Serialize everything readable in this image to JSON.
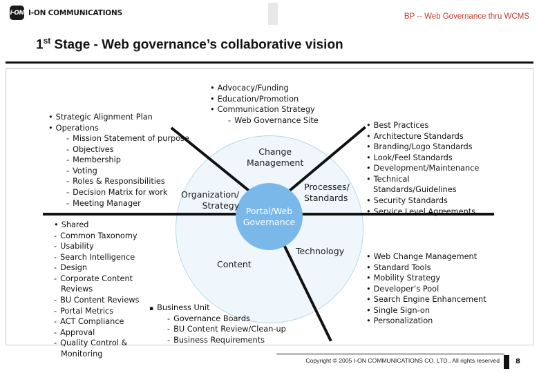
{
  "header": {
    "logo_text": "I-ON COMMUNICATIONS",
    "logo_mark": "i-ON",
    "bp_label": "BP -- Web Governance thru WCMS",
    "title_prefix": "1",
    "title_sup": "st",
    "title_rest": " Stage - Web governance’s collaborative vision"
  },
  "center": {
    "inner_label": "Portal/Web\nGovernance",
    "outer_circle_color": "#eff7fc",
    "inner_circle_color": "#7ab8ea",
    "quadrants": {
      "change_management": "Change\nManagement",
      "processes_standards": "Processes/\nStandards",
      "technology": "Technology",
      "content": "Content",
      "organization_strategy": "Organization/\nStrategy"
    }
  },
  "blocks": {
    "top": [
      {
        "level": 1,
        "bullet": "dot",
        "text": "Advocacy/Funding"
      },
      {
        "level": 1,
        "bullet": "dot",
        "text": "Education/Promotion"
      },
      {
        "level": 1,
        "bullet": "dot",
        "text": "Communication Strategy"
      },
      {
        "level": 2,
        "bullet": "dash",
        "text": "Web Governance Site"
      }
    ],
    "left": [
      {
        "level": 1,
        "bullet": "dot",
        "text": "Strategic Alignment Plan"
      },
      {
        "level": 1,
        "bullet": "dot",
        "text": "Operations"
      },
      {
        "level": 2,
        "bullet": "dash",
        "text": "Mission Statement of purpose"
      },
      {
        "level": 2,
        "bullet": "dash",
        "text": "Objectives"
      },
      {
        "level": 2,
        "bullet": "dash",
        "text": "Membership"
      },
      {
        "level": 2,
        "bullet": "dash",
        "text": "Voting"
      },
      {
        "level": 2,
        "bullet": "dash",
        "text": "Roles & Responsibilities"
      },
      {
        "level": 2,
        "bullet": "dash",
        "text": "Decision Matrix for work"
      },
      {
        "level": 2,
        "bullet": "dash",
        "text": "Meeting Manager"
      }
    ],
    "right": [
      {
        "level": 1,
        "bullet": "dot",
        "text": "Best Practices"
      },
      {
        "level": 1,
        "bullet": "dot",
        "text": "Architecture Standards"
      },
      {
        "level": 1,
        "bullet": "dot",
        "text": "Branding/Logo Standards"
      },
      {
        "level": 1,
        "bullet": "dot",
        "text": "Look/Feel Standards"
      },
      {
        "level": 1,
        "bullet": "dot",
        "text": "Development/Maintenance"
      },
      {
        "level": 1,
        "bullet": "dot",
        "text": "Technical"
      },
      {
        "level": 1,
        "bullet": "none",
        "text": "Standards/Guidelines"
      },
      {
        "level": 1,
        "bullet": "dot",
        "text": "Security Standards"
      },
      {
        "level": 1,
        "bullet": "dot",
        "text": "Service Level Agreements"
      }
    ],
    "lower_left": [
      {
        "level": 1,
        "bullet": "dot",
        "text": "Shared"
      },
      {
        "level": 1,
        "bullet": "dash",
        "text": "Common Taxonomy"
      },
      {
        "level": 1,
        "bullet": "dash",
        "text": "Usability"
      },
      {
        "level": 1,
        "bullet": "dash",
        "text": "Search Intelligence"
      },
      {
        "level": 1,
        "bullet": "dash",
        "text": "Design"
      },
      {
        "level": 1,
        "bullet": "dash",
        "text": "Corporate Content"
      },
      {
        "level": 1,
        "bullet": "none",
        "text": "Reviews"
      },
      {
        "level": 1,
        "bullet": "dash",
        "text": "BU Content Reviews"
      },
      {
        "level": 1,
        "bullet": "dash",
        "text": "Portal Metrics"
      },
      {
        "level": 1,
        "bullet": "dash",
        "text": "ACT Compliance"
      },
      {
        "level": 1,
        "bullet": "dash",
        "text": "Approval"
      },
      {
        "level": 1,
        "bullet": "dash",
        "text": "Quality Control &"
      },
      {
        "level": 1,
        "bullet": "none",
        "text": "Monitoring"
      }
    ],
    "business_unit": [
      {
        "level": 1,
        "bullet": "sq",
        "text": "Business Unit"
      },
      {
        "level": 2,
        "bullet": "dash",
        "text": "Governance Boards"
      },
      {
        "level": 2,
        "bullet": "dash",
        "text": "BU Content Review/Clean-up"
      },
      {
        "level": 2,
        "bullet": "dash",
        "text": "Business Requirements"
      }
    ],
    "bottom_right": [
      {
        "level": 1,
        "bullet": "dot",
        "text": "Web Change Management"
      },
      {
        "level": 1,
        "bullet": "dot",
        "text": "Standard Tools"
      },
      {
        "level": 1,
        "bullet": "dot",
        "text": "Mobility Strategy"
      },
      {
        "level": 1,
        "bullet": "dot",
        "text": "Developer’s Pool"
      },
      {
        "level": 1,
        "bullet": "dot",
        "text": "Search Engine Enhancement"
      },
      {
        "level": 1,
        "bullet": "dot",
        "text": "Single Sign-on"
      },
      {
        "level": 1,
        "bullet": "dot",
        "text": "Personalization"
      }
    ]
  },
  "footer": {
    "copyright": "Copyright © 2005 I-ON COMMUNICATIONS CO. LTD., All rights reserved",
    "page_number": "8"
  }
}
